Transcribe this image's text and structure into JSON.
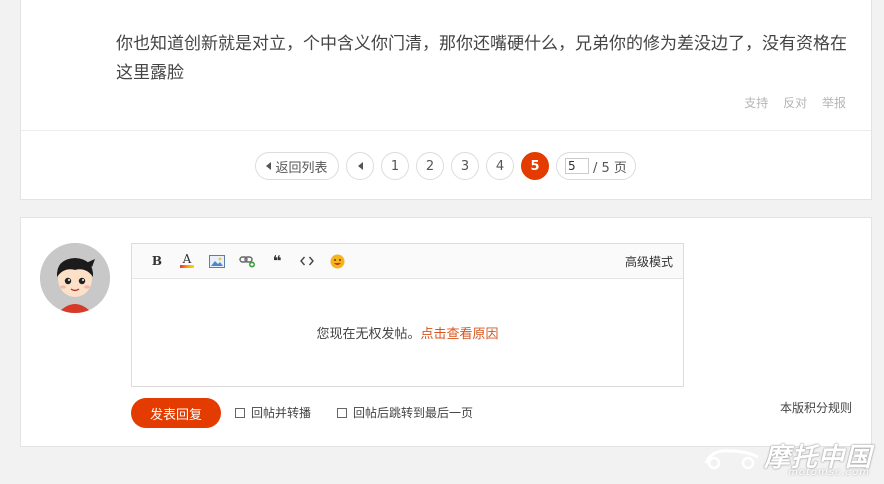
{
  "post": {
    "text": "你也知道创新就是对立，个中含义你门清，那你还嘴硬什么，兄弟你的修为差没边了，没有资格在这里露脸",
    "actions": {
      "support": "支持",
      "oppose": "反对",
      "report": "举报"
    }
  },
  "pager": {
    "back_label": "返回列表",
    "pages": [
      "1",
      "2",
      "3",
      "4",
      "5"
    ],
    "current": "5",
    "jump_value": "5",
    "total_label": "/ 5 页"
  },
  "editor": {
    "advanced_mode": "高级模式",
    "toolbar": {
      "bold": "B",
      "font_color": "A",
      "quote": "❝"
    },
    "notice": "您现在无权发帖。",
    "notice_link": "点击查看原因"
  },
  "reply": {
    "submit_label": "发表回复",
    "opt_repost": "回帖并转播",
    "opt_jump_last": "回帖后跳转到最后一页",
    "rules_label": "本版积分规则"
  },
  "watermark": {
    "cn": "摩托中国",
    "en": "motomsc.com"
  },
  "colors": {
    "accent": "#e33b00",
    "link": "#d9541c"
  }
}
